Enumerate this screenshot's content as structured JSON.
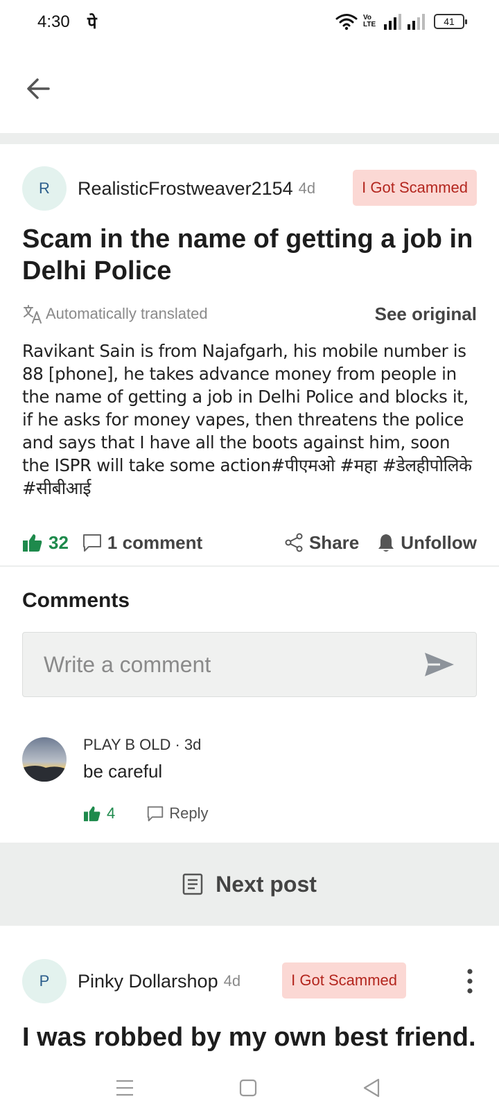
{
  "status_bar": {
    "time": "4:30",
    "extra": "पे",
    "volte": "Vo LTE",
    "battery": "41"
  },
  "post": {
    "author_initial": "R",
    "author": "RealisticFrostweaver2154",
    "age": "4d",
    "tag": "I Got Scammed",
    "title": "Scam in the name of getting a job in Delhi Police",
    "translated_label": "Automatically translated",
    "see_original": "See original",
    "body": "Ravikant Sain is from Najafgarh, his mobile number is 88 [phone], he takes advance money from people in the name of getting a job in Delhi Police and blocks it, if he asks for money vapes, then threatens the police and says that I have all the boots against him, soon the ISPR will take some action#पीएमओ #महा #डेलहीपोलिके #सीबीआई",
    "likes": "32",
    "comments_label": "1 comment",
    "share_label": "Share",
    "unfollow_label": "Unfollow"
  },
  "comments": {
    "heading": "Comments",
    "input_placeholder": "Write a comment",
    "items": [
      {
        "meta": "PLAY B OLD · 3d",
        "text": "be careful",
        "likes": "4",
        "reply_label": "Reply"
      }
    ]
  },
  "next_post_label": "Next post",
  "next_post": {
    "author_initial": "P",
    "author": "Pinky Dollarshop",
    "age": "4d",
    "tag": "I Got Scammed",
    "title": "I was robbed by my own best friend."
  },
  "colors": {
    "accent_green": "#1e8a4c",
    "tag_bg": "#fbd8d4",
    "tag_text": "#b3261e",
    "avatar_bg": "#e3f2ee",
    "band_gray": "#eceeed"
  },
  "icons": [
    "wifi-icon",
    "signal-icon",
    "battery-icon",
    "back-arrow-icon",
    "translate-icon",
    "thumbs-up-icon",
    "comment-icon",
    "share-icon",
    "bell-icon",
    "send-icon",
    "reply-icon",
    "article-icon",
    "more-vertical-icon",
    "menu-icon",
    "home-square-icon",
    "back-triangle-icon"
  ]
}
